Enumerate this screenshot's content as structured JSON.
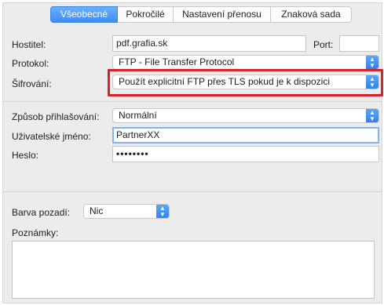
{
  "tabs": [
    {
      "label": "Všeobecné",
      "active": true
    },
    {
      "label": "Pokročilé",
      "active": false
    },
    {
      "label": "Nastavení přenosu",
      "active": false
    },
    {
      "label": "Znaková sada",
      "active": false
    }
  ],
  "server": {
    "host_label": "Hostitel:",
    "host_value": "pdf.grafia.sk",
    "port_label": "Port:",
    "port_value": "",
    "protocol_label": "Protokol:",
    "protocol_value": "FTP - File Transfer Protocol",
    "encryption_label": "Šifrování:",
    "encryption_value": "Použít explicitní FTP přes TLS pokud je k dispozici"
  },
  "login": {
    "logon_type_label": "Způsob přihlašování:",
    "logon_type_value": "Normální",
    "username_label": "Uživatelské jméno:",
    "username_value": "PartnerXX",
    "password_label": "Heslo:",
    "password_value": "••••••••"
  },
  "appearance": {
    "background_label": "Barva pozadí:",
    "background_value": "Nic",
    "notes_label": "Poznámky:",
    "notes_value": ""
  },
  "colors": {
    "accent": "#3f8df2",
    "highlight_box": "#d9222c",
    "panel": "#ececec"
  }
}
